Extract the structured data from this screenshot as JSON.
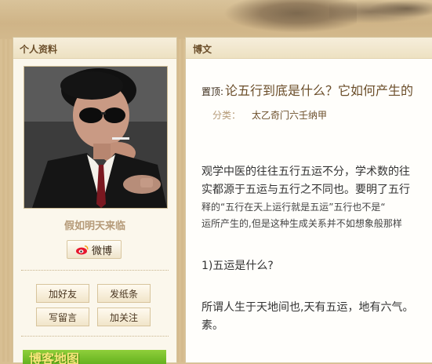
{
  "profile": {
    "module_title": "个人资料",
    "username": "假如明天来临",
    "weibo_label": "微博",
    "actions": [
      "加好友",
      "发纸条",
      "写留言",
      "加关注"
    ],
    "map_banner": "博客地图"
  },
  "article": {
    "module_title": "博文",
    "pin_label": "置顶:",
    "title": "论五行到底是什么？它如何产生的",
    "category_label": "分类：",
    "category_value": "太乙奇门六壬纳甲",
    "lines": [
      "观学中医的往往五行五运不分，学术数的往",
      "实都源于五运与五行之不同也。要明了五行",
      "释的“五行在天上运行就是五运”五行也不是“",
      "运所产生的,但是这种生成关系并不如想象般那样",
      "1)五运是什么?",
      "所谓人生于天地间也,天有五运，地有六气。",
      "素。"
    ]
  },
  "colors": {
    "accent_brown": "#6b4e2a",
    "muted_tan": "#b59a78",
    "map_green": "#65b21f"
  }
}
